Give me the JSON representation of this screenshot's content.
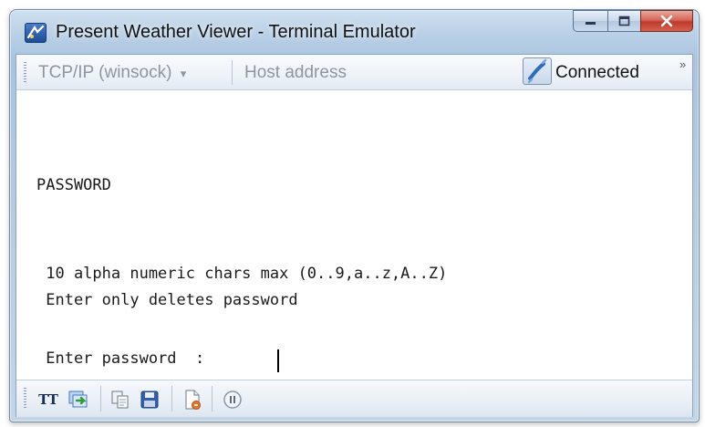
{
  "window": {
    "title": "Present Weather Viewer - Terminal Emulator",
    "buttons": {
      "minimize": "minimize",
      "maximize": "maximize",
      "close": "close"
    }
  },
  "connection_toolbar": {
    "protocol": "TCP/IP (winsock)",
    "protocol_arrow": "▾",
    "host_placeholder": "Host address",
    "status": "Connected",
    "overflow": "»"
  },
  "terminal": {
    "lines": [
      "PASSWORD",
      " 10 alpha numeric chars max (0..9,a..z,A..Z)",
      " Enter only deletes password",
      " Enter password  : "
    ]
  },
  "bottom_toolbar": {
    "icons": [
      "text-font-icon",
      "transfer-icon",
      "copy-icon",
      "save-icon",
      "new-document-icon",
      "pause-icon"
    ],
    "tt_label": "TT"
  },
  "colors": {
    "title_bar": "#b9d0e6",
    "close_button": "#c0392b",
    "accent_blue": "#2f6bbd"
  }
}
